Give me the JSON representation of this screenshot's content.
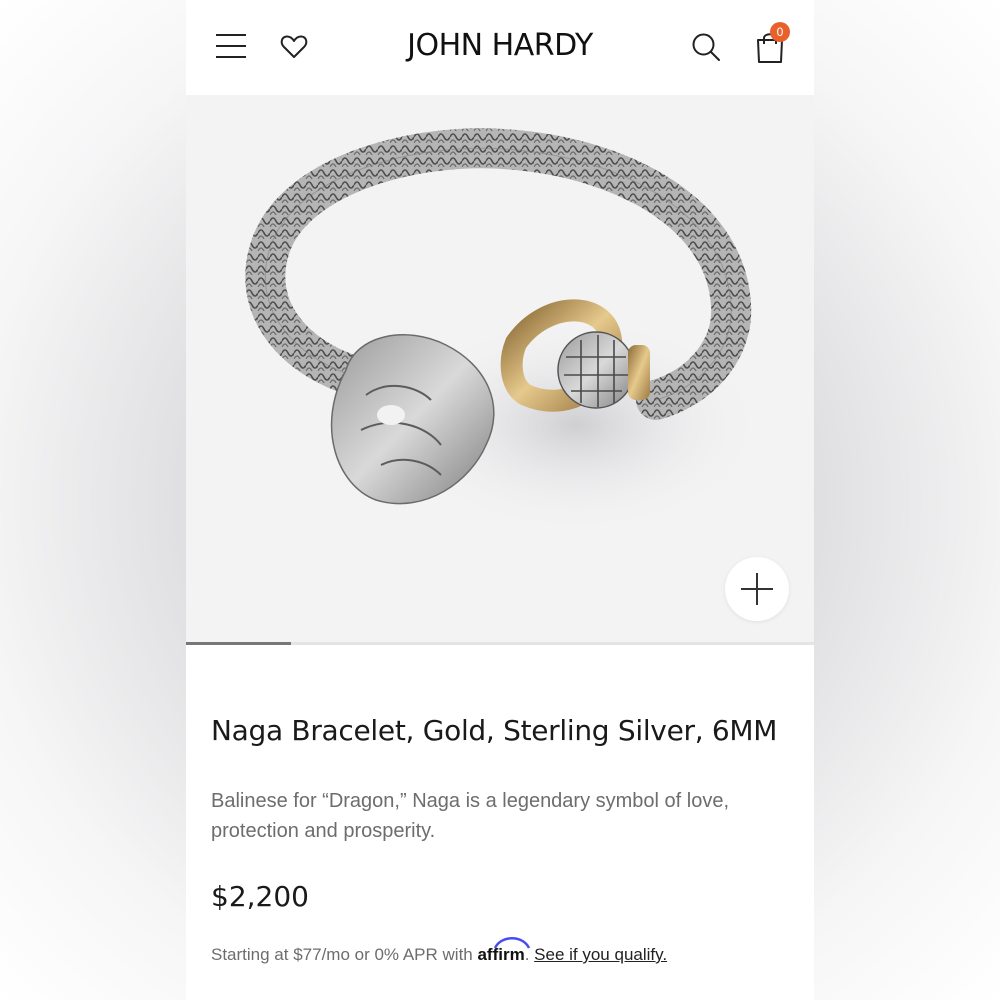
{
  "header": {
    "brand": "JOHN HARDY",
    "menu_icon": "hamburger-menu-icon",
    "wishlist_icon": "heart-icon",
    "search_icon": "search-icon",
    "bag_icon": "shopping-bag-icon",
    "bag_count": "0",
    "badge_color": "#e8612c"
  },
  "gallery": {
    "zoom_icon": "plus-icon",
    "current_slide": 1,
    "slide_count": 6
  },
  "product": {
    "title": "Naga Bracelet, Gold, Sterling Silver, 6MM",
    "description": "Balinese for “Dragon,” Naga is a legendary symbol of love, protection and prosperity.",
    "price": "$2,200"
  },
  "financing": {
    "prefix": "Starting at $77/mo or 0% APR with ",
    "provider": "affirm",
    "separator": ". ",
    "link": "See if you qualify."
  }
}
